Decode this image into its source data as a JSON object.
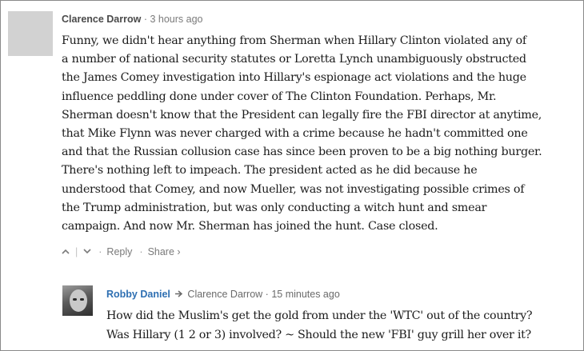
{
  "comment": {
    "author": "Clarence Darrow",
    "time": "3 hours ago",
    "lines": [
      "Funny, we didn't hear anything from Sherman when Hillary Clinton violated any of",
      "a number of national security statutes or Loretta Lynch unambiguously obstructed",
      "the James Comey investigation into Hillary's espionage act violations and the huge",
      "influence peddling done under cover of The Clinton Foundation. Perhaps, Mr.",
      "Sherman doesn't know that the President can legally fire the FBI director at anytime,",
      "that Mike Flynn was never charged with a crime because he hadn't committed one",
      "and that the Russian collusion case has since been proven to be a big nothing burger.",
      "There's nothing left to impeach. The president acted as he did because he",
      "understood that Comey, and now Mueller, was not investigating possible crimes of",
      "the Trump administration, but was only conducting a witch hunt and smear",
      "campaign. And now Mr. Sherman has joined the hunt. Case closed."
    ],
    "actions": {
      "upvote_icon": "chevron-up-icon",
      "downvote_icon": "chevron-down-icon",
      "reply_label": "Reply",
      "share_label": "Share ›"
    }
  },
  "reply": {
    "author": "Robby Daniel",
    "reply_to": "Clarence Darrow",
    "time": "15 minutes ago",
    "lines": [
      "How did the Muslim's get the gold from under the 'WTC' out of the country?",
      "Was Hillary (1 2 or 3) involved? ~ Should the new 'FBI' guy grill her over it?"
    ]
  },
  "colors": {
    "author_link": "#2e6fb2",
    "meta_text": "#7a7a7a",
    "body_text": "#1b1b1b"
  }
}
